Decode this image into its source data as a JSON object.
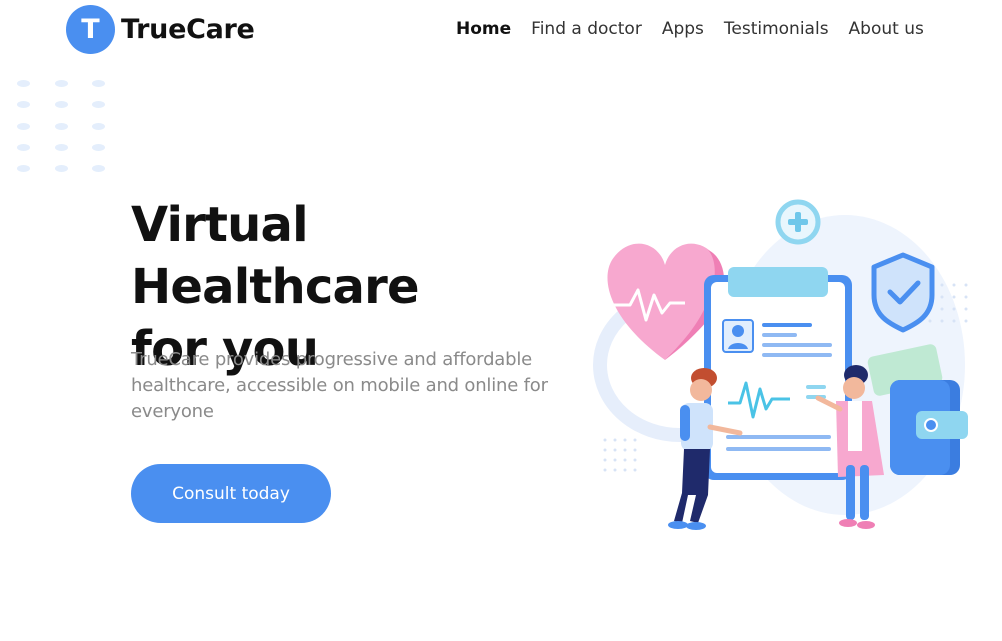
{
  "brand": {
    "logo_letter": "T",
    "name": "TrueCare",
    "color": "#4a8ff0"
  },
  "nav": [
    {
      "label": "Home",
      "active": true
    },
    {
      "label": "Find a doctor",
      "active": false
    },
    {
      "label": "Apps",
      "active": false
    },
    {
      "label": "Testimonials",
      "active": false
    },
    {
      "label": "About us",
      "active": false
    }
  ],
  "hero": {
    "title_line1": "Virtual Healthcare",
    "title_line2": "for you",
    "description": "TrueCare provides progressive and affordable healthcare, accessible on mobile and online for everyone",
    "cta_label": "Consult today"
  },
  "illustration": {
    "icons": [
      "heart-rate-icon",
      "medical-cross-icon",
      "shield-check-icon",
      "wallet-icon",
      "clipboard-icon",
      "patient-figure",
      "doctor-figure"
    ]
  }
}
